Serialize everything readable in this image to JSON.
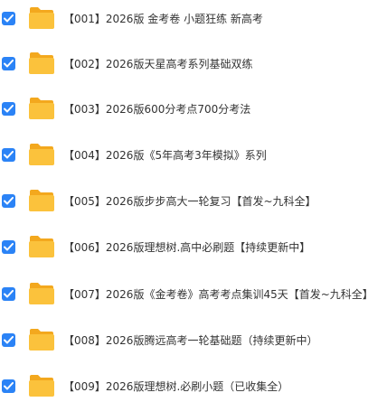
{
  "colors": {
    "checkbox": "#2b83f6",
    "folder_body": "#fbc23c",
    "folder_back": "#f3a81e",
    "text": "#333333"
  },
  "files": [
    {
      "checked": true,
      "icon": "folder-icon",
      "name": "【001】2026版 金考卷 小题狂练 新高考"
    },
    {
      "checked": true,
      "icon": "folder-icon",
      "name": "【002】2026版天星高考系列基础双练"
    },
    {
      "checked": true,
      "icon": "folder-icon",
      "name": "【003】2026版600分考点700分考法"
    },
    {
      "checked": true,
      "icon": "folder-icon",
      "name": "【004】2026版《5年高考3年模拟》系列"
    },
    {
      "checked": true,
      "icon": "folder-icon",
      "name": "【005】2026版步步高大一轮复习【首发~九科全】"
    },
    {
      "checked": true,
      "icon": "folder-icon",
      "name": "【006】2026版理想树.高中必刷题【持续更新中】"
    },
    {
      "checked": true,
      "icon": "folder-icon",
      "name": "【007】2026版《金考卷》高考考点集训45天【首发~九科全】"
    },
    {
      "checked": true,
      "icon": "folder-icon",
      "name": "【008】2026版腾远高考一轮基础题（持续更新中）"
    },
    {
      "checked": true,
      "icon": "folder-icon",
      "name": "【009】2026版理想树.必刷小题（已收集全）"
    }
  ]
}
